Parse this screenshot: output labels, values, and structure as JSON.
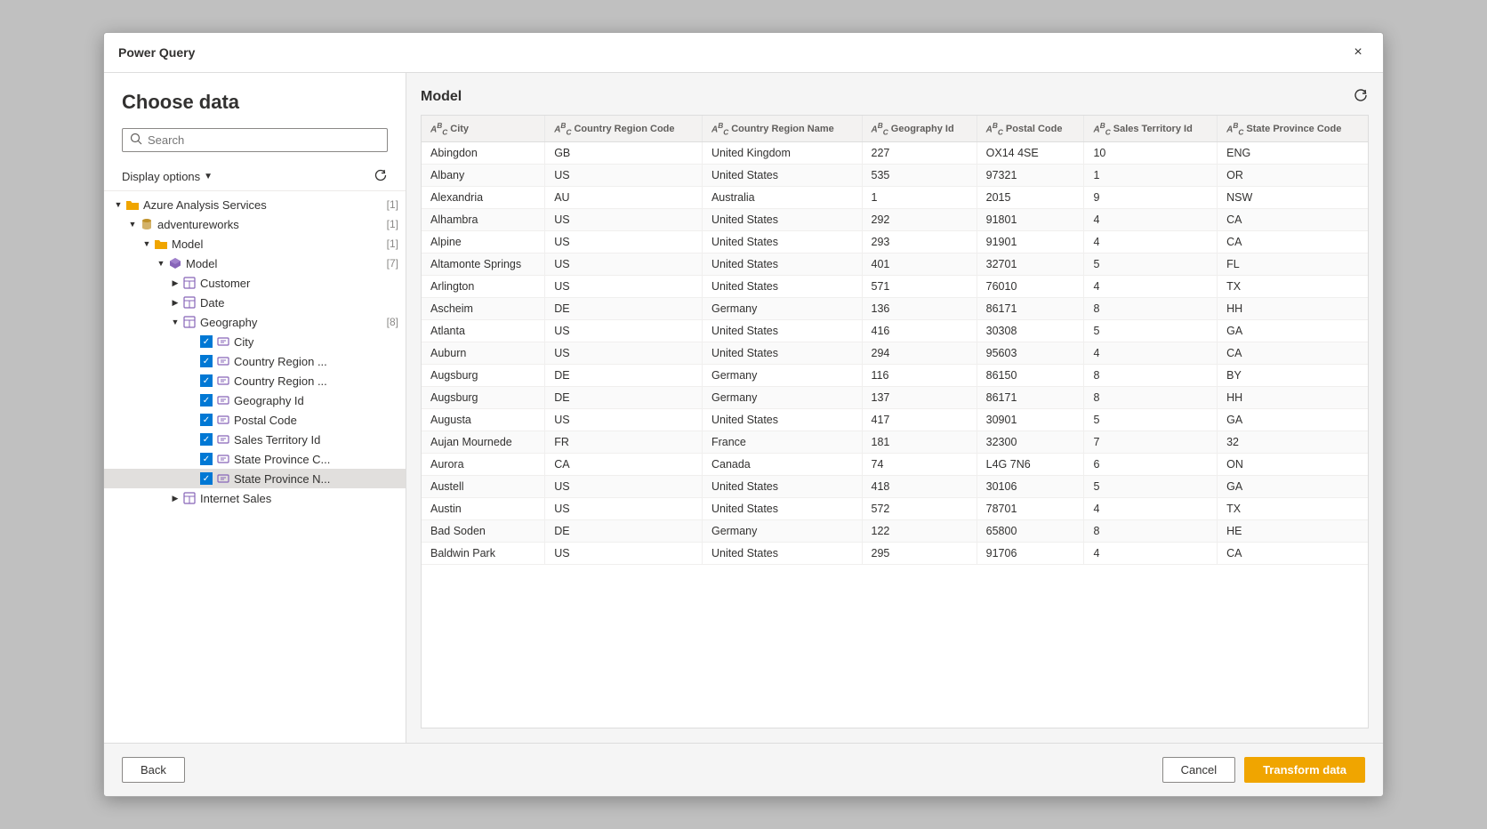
{
  "dialog": {
    "title": "Power Query",
    "close_label": "×"
  },
  "left_panel": {
    "heading": "Choose data",
    "search_placeholder": "Search",
    "display_options_label": "Display options",
    "tree": [
      {
        "id": "aas",
        "label": "Azure Analysis Services",
        "type": "folder",
        "indent": 0,
        "arrow": "expanded",
        "count": "[1]"
      },
      {
        "id": "aw",
        "label": "adventureworks",
        "type": "cylinder",
        "indent": 1,
        "arrow": "expanded",
        "count": "[1]"
      },
      {
        "id": "model_folder",
        "label": "Model",
        "type": "folder",
        "indent": 2,
        "arrow": "expanded",
        "count": "[1]"
      },
      {
        "id": "model_cube",
        "label": "Model",
        "type": "cube",
        "indent": 3,
        "arrow": "expanded",
        "count": "[7]"
      },
      {
        "id": "customer",
        "label": "Customer",
        "type": "table",
        "indent": 4,
        "arrow": "collapsed",
        "count": ""
      },
      {
        "id": "date",
        "label": "Date",
        "type": "table",
        "indent": 4,
        "arrow": "collapsed",
        "count": ""
      },
      {
        "id": "geography",
        "label": "Geography",
        "type": "table",
        "indent": 4,
        "arrow": "expanded",
        "count": "[8]"
      },
      {
        "id": "city",
        "label": "City",
        "type": "field",
        "indent": 5,
        "arrow": "none",
        "count": "",
        "checked": true
      },
      {
        "id": "country_region_code",
        "label": "Country Region ...",
        "type": "field",
        "indent": 5,
        "arrow": "none",
        "count": "",
        "checked": true
      },
      {
        "id": "country_region_name",
        "label": "Country Region ...",
        "type": "field",
        "indent": 5,
        "arrow": "none",
        "count": "",
        "checked": true
      },
      {
        "id": "geography_id",
        "label": "Geography Id",
        "type": "field",
        "indent": 5,
        "arrow": "none",
        "count": "",
        "checked": true
      },
      {
        "id": "postal_code",
        "label": "Postal Code",
        "type": "field",
        "indent": 5,
        "arrow": "none",
        "count": "",
        "checked": true
      },
      {
        "id": "sales_territory_id",
        "label": "Sales Territory Id",
        "type": "field",
        "indent": 5,
        "arrow": "none",
        "count": "",
        "checked": true
      },
      {
        "id": "state_province_c",
        "label": "State Province C...",
        "type": "field",
        "indent": 5,
        "arrow": "none",
        "count": "",
        "checked": true
      },
      {
        "id": "state_province_n",
        "label": "State Province N...",
        "type": "field",
        "indent": 5,
        "arrow": "none",
        "count": "",
        "checked": true,
        "selected": true
      },
      {
        "id": "internet_sales",
        "label": "Internet Sales",
        "type": "table",
        "indent": 4,
        "arrow": "collapsed",
        "count": ""
      }
    ]
  },
  "right_panel": {
    "model_label": "Model",
    "columns": [
      {
        "id": "city",
        "label": "City",
        "type": "ABC"
      },
      {
        "id": "country_region_code",
        "label": "Country Region Code",
        "type": "ABC"
      },
      {
        "id": "country_region_name",
        "label": "Country Region Name",
        "type": "ABC"
      },
      {
        "id": "geography_id",
        "label": "Geography Id",
        "type": "ABC"
      },
      {
        "id": "postal_code",
        "label": "Postal Code",
        "type": "ABC"
      },
      {
        "id": "sales_territory_id",
        "label": "Sales Territory Id",
        "type": "ABC"
      },
      {
        "id": "state_province_code",
        "label": "State Province Code",
        "type": "ABC"
      }
    ],
    "rows": [
      [
        "Abingdon",
        "GB",
        "United Kingdom",
        "227",
        "OX14 4SE",
        "10",
        "ENG"
      ],
      [
        "Albany",
        "US",
        "United States",
        "535",
        "97321",
        "1",
        "OR"
      ],
      [
        "Alexandria",
        "AU",
        "Australia",
        "1",
        "2015",
        "9",
        "NSW"
      ],
      [
        "Alhambra",
        "US",
        "United States",
        "292",
        "91801",
        "4",
        "CA"
      ],
      [
        "Alpine",
        "US",
        "United States",
        "293",
        "91901",
        "4",
        "CA"
      ],
      [
        "Altamonte Springs",
        "US",
        "United States",
        "401",
        "32701",
        "5",
        "FL"
      ],
      [
        "Arlington",
        "US",
        "United States",
        "571",
        "76010",
        "4",
        "TX"
      ],
      [
        "Ascheim",
        "DE",
        "Germany",
        "136",
        "86171",
        "8",
        "HH"
      ],
      [
        "Atlanta",
        "US",
        "United States",
        "416",
        "30308",
        "5",
        "GA"
      ],
      [
        "Auburn",
        "US",
        "United States",
        "294",
        "95603",
        "4",
        "CA"
      ],
      [
        "Augsburg",
        "DE",
        "Germany",
        "116",
        "86150",
        "8",
        "BY"
      ],
      [
        "Augsburg",
        "DE",
        "Germany",
        "137",
        "86171",
        "8",
        "HH"
      ],
      [
        "Augusta",
        "US",
        "United States",
        "417",
        "30901",
        "5",
        "GA"
      ],
      [
        "Aujan Mournede",
        "FR",
        "France",
        "181",
        "32300",
        "7",
        "32"
      ],
      [
        "Aurora",
        "CA",
        "Canada",
        "74",
        "L4G 7N6",
        "6",
        "ON"
      ],
      [
        "Austell",
        "US",
        "United States",
        "418",
        "30106",
        "5",
        "GA"
      ],
      [
        "Austin",
        "US",
        "United States",
        "572",
        "78701",
        "4",
        "TX"
      ],
      [
        "Bad Soden",
        "DE",
        "Germany",
        "122",
        "65800",
        "8",
        "HE"
      ],
      [
        "Baldwin Park",
        "US",
        "United States",
        "295",
        "91706",
        "4",
        "CA"
      ]
    ]
  },
  "footer": {
    "back_label": "Back",
    "cancel_label": "Cancel",
    "transform_data_label": "Transform data"
  }
}
